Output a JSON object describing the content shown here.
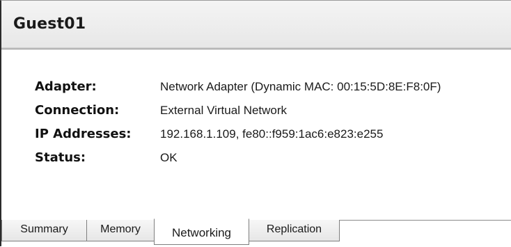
{
  "vm": {
    "name": "Guest01"
  },
  "details": [
    {
      "label": "Adapter:",
      "value": "Network Adapter (Dynamic MAC: 00:15:5D:8E:F8:0F)"
    },
    {
      "label": "Connection:",
      "value": "External Virtual Network"
    },
    {
      "label": "IP Addresses:",
      "value": "192.168.1.109,  fe80::f959:1ac6:e823:e255"
    },
    {
      "label": "Status:",
      "value": "OK"
    }
  ],
  "tabs": [
    {
      "label": "Summary",
      "active": false
    },
    {
      "label": "Memory",
      "active": false
    },
    {
      "label": "Networking",
      "active": true
    },
    {
      "label": "Replication",
      "active": false
    }
  ]
}
